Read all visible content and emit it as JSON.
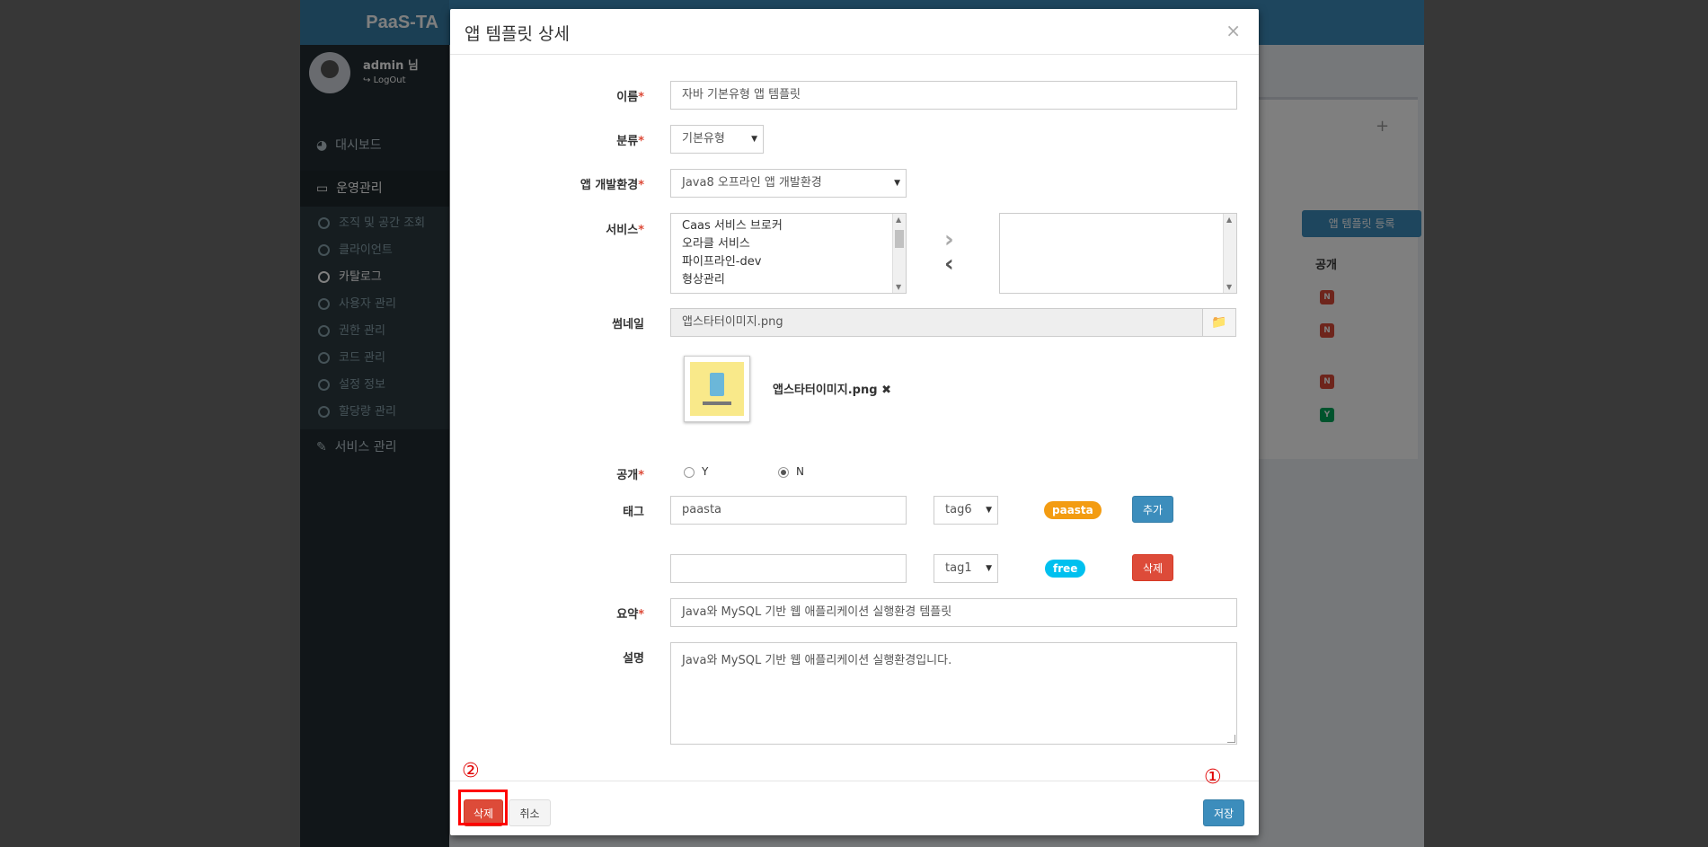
{
  "app": {
    "brand": "PaaS-TA",
    "user": {
      "name": "admin 님",
      "logout": "LogOut"
    },
    "menu": {
      "dashboard": "대시보드",
      "operations": "운영관리",
      "sub_items": [
        "조직 및 공간 조회",
        "클라이언트",
        "카탈로그",
        "사용자 관리",
        "권한 관리",
        "코드 관리",
        "설정 정보",
        "할당량 관리"
      ],
      "service_mgmt": "서비스 관리"
    },
    "background": {
      "register_button": "앱 템플릿 등록",
      "column_public": "공개",
      "badges": [
        "N",
        "N",
        "N",
        "Y"
      ]
    }
  },
  "modal": {
    "title": "앱 템플릿 상세",
    "close": "×",
    "fields": {
      "name": {
        "label": "이름",
        "value": "자바 기본유형 앱 템플릿"
      },
      "category": {
        "label": "분류",
        "value": "기본유형"
      },
      "dev_env": {
        "label": "앱 개발환경",
        "value": "Java8 오프라인 앱 개발환경"
      },
      "services": {
        "label": "서비스",
        "options": [
          "Caas 서비스 브로커",
          "오라클 서비스",
          "파이프라인-dev",
          "형상관리"
        ],
        "selected": []
      },
      "thumbnail": {
        "label": "썸네일",
        "filename": "앱스타터이미지.png",
        "preview_name": "앱스타터이미지.png"
      },
      "public": {
        "label": "공개",
        "options": [
          "Y",
          "N"
        ],
        "selected": "N"
      },
      "tags": {
        "label": "태그",
        "rows": [
          {
            "input": "paasta",
            "select": "tag6",
            "pill": "paasta",
            "pill_color": "#f39c12",
            "button": "추가"
          },
          {
            "input": "",
            "select": "tag1",
            "pill": "free",
            "pill_color": "#00c0ef",
            "button": "삭제"
          }
        ]
      },
      "summary": {
        "label": "요약",
        "value": "Java와 MySQL 기반 웹 애플리케이션 실행환경 템플릿"
      },
      "description": {
        "label": "설명",
        "value": "Java와 MySQL 기반 웹 애플리케이션 실행환경입니다."
      }
    },
    "footer": {
      "delete": "삭제",
      "cancel": "취소",
      "save": "저장"
    },
    "annotations": {
      "delete_marker": "②",
      "save_marker": "①"
    }
  }
}
